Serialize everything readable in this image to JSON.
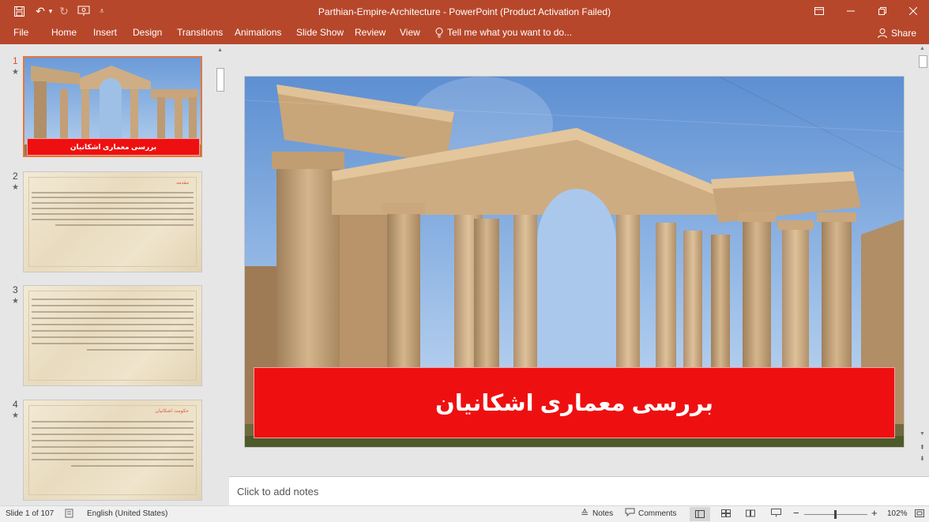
{
  "window": {
    "title": "Parthian-Empire-Architecture - PowerPoint (Product Activation Failed)"
  },
  "qat": {
    "save_icon": "save-icon",
    "undo_icon": "undo-icon",
    "redo_icon": "redo-icon",
    "present_icon": "start-from-beginning-icon"
  },
  "ribbon": {
    "tabs": [
      "File",
      "Home",
      "Insert",
      "Design",
      "Transitions",
      "Animations",
      "Slide Show",
      "Review",
      "View"
    ],
    "tell_me": "Tell me what you want to do...",
    "share": "Share"
  },
  "thumbnails": [
    {
      "number": "1",
      "title": "بررسی معماری اشکانیان",
      "selected": true
    },
    {
      "number": "2",
      "heading": "مقدمه"
    },
    {
      "number": "3"
    },
    {
      "number": "4",
      "heading": "حکومت اشکانیان"
    }
  ],
  "slide": {
    "title": "بررسی معماری اشکانیان"
  },
  "notes": {
    "placeholder": "Click to add notes"
  },
  "status": {
    "slide_info": "Slide 1 of 107",
    "language": "English (United States)",
    "notes_label": "Notes",
    "comments_label": "Comments",
    "zoom": "102%",
    "zoom_percent": 102
  },
  "colors": {
    "accent": "#b7472a",
    "banner": "#ee1010",
    "selection": "#e4783b"
  }
}
